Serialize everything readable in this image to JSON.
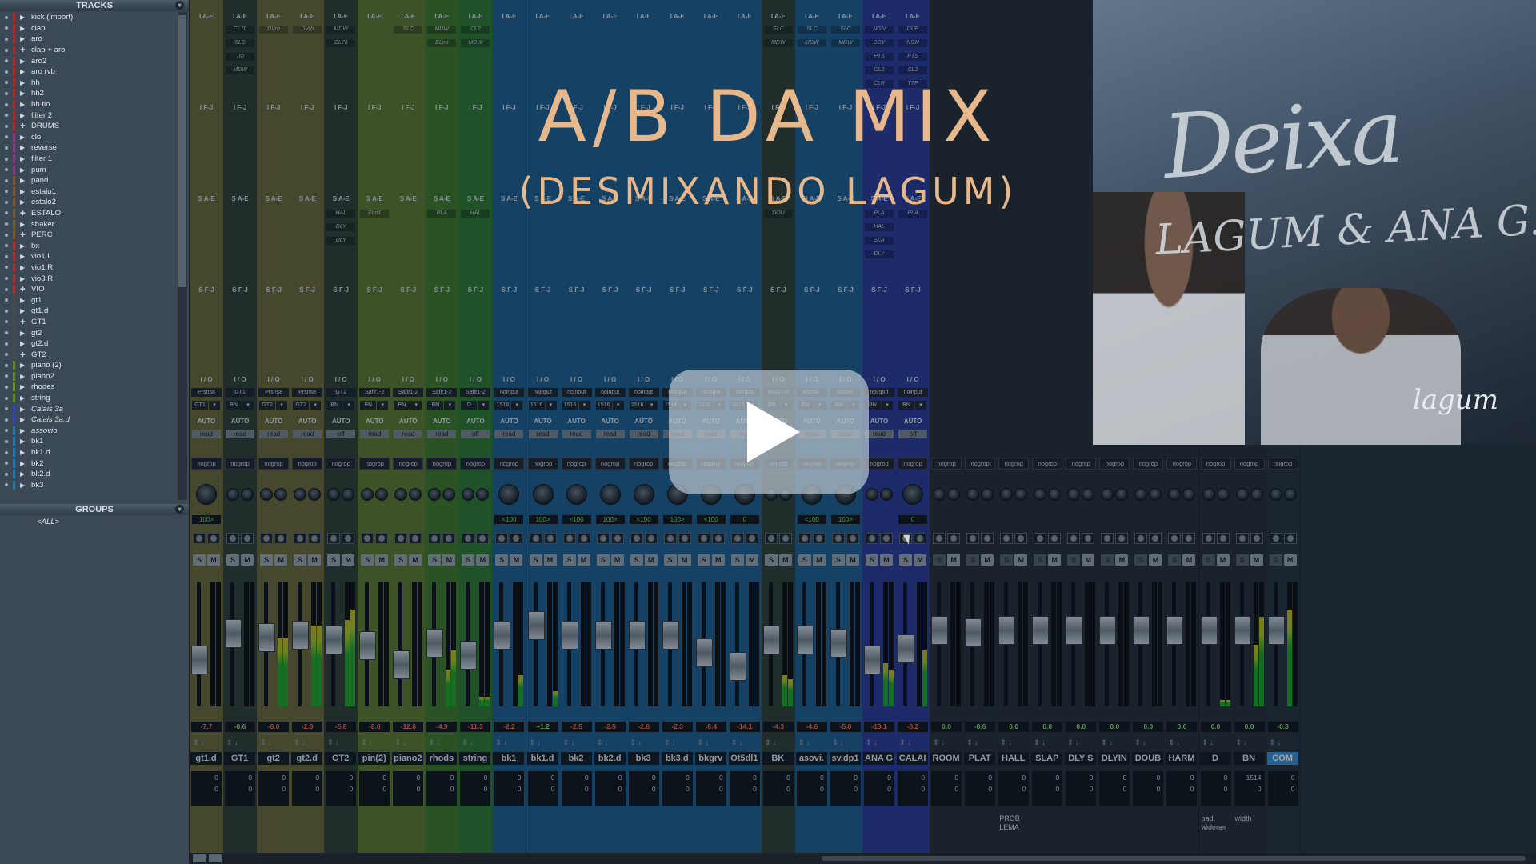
{
  "tracks_panel": {
    "header": "TRACKS",
    "tracks": [
      {
        "name": "kick (import)",
        "color": "#b02a2a",
        "arrow": "▶",
        "italic": false
      },
      {
        "name": "clap",
        "color": "#b02a2a",
        "arrow": "▶",
        "italic": false
      },
      {
        "name": "aro",
        "color": "#b02a2a",
        "arrow": "▶",
        "italic": false
      },
      {
        "name": "clap + aro",
        "color": "#b02a2a",
        "arrow": "✚",
        "italic": false
      },
      {
        "name": "aro2",
        "color": "#b02a2a",
        "arrow": "▶",
        "italic": false
      },
      {
        "name": "aro rvb",
        "color": "#b02a2a",
        "arrow": "▶",
        "italic": false
      },
      {
        "name": "hh",
        "color": "#b02a2a",
        "arrow": "▶",
        "italic": false
      },
      {
        "name": "hh2",
        "color": "#b02a2a",
        "arrow": "▶",
        "italic": false
      },
      {
        "name": "hh tio",
        "color": "#b02a2a",
        "arrow": "▶",
        "italic": false
      },
      {
        "name": "filter 2",
        "color": "#b02a2a",
        "arrow": "▶",
        "italic": false
      },
      {
        "name": "DRUMS",
        "color": "#b02a2a",
        "arrow": "✚",
        "italic": false
      },
      {
        "name": "clo",
        "color": "#8a3a8a",
        "arrow": "▶",
        "italic": false
      },
      {
        "name": "reverse",
        "color": "#8a3a8a",
        "arrow": "▶",
        "italic": false
      },
      {
        "name": "filter 1",
        "color": "#8a3a8a",
        "arrow": "▶",
        "italic": false
      },
      {
        "name": "pum",
        "color": "#8a3a8a",
        "arrow": "▶",
        "italic": false
      },
      {
        "name": "pand",
        "color": "#7a5a30",
        "arrow": "▶",
        "italic": false
      },
      {
        "name": "estalo1",
        "color": "#7a5a30",
        "arrow": "▶",
        "italic": false
      },
      {
        "name": "estalo2",
        "color": "#7a5a30",
        "arrow": "▶",
        "italic": false
      },
      {
        "name": "ESTALO",
        "color": "#7a5a30",
        "arrow": "✚",
        "italic": false
      },
      {
        "name": "shaker",
        "color": "#7a5a30",
        "arrow": "▶",
        "italic": false
      },
      {
        "name": "PERC",
        "color": "#7a5a30",
        "arrow": "✚",
        "italic": false
      },
      {
        "name": "bx",
        "color": "#b03030",
        "arrow": "▶",
        "italic": false
      },
      {
        "name": "vio1 L",
        "color": "#b03030",
        "arrow": "▶",
        "italic": false
      },
      {
        "name": "vio1 R",
        "color": "#b03030",
        "arrow": "▶",
        "italic": false
      },
      {
        "name": "vio3 R",
        "color": "#b03030",
        "arrow": "▶",
        "italic": false
      },
      {
        "name": "VIO",
        "color": "#b03030",
        "arrow": "✚",
        "italic": false
      },
      {
        "name": "gt1",
        "color": "#4a4a4a",
        "arrow": "▶",
        "italic": false
      },
      {
        "name": "gt1.d",
        "color": "#4a4a4a",
        "arrow": "▶",
        "italic": false
      },
      {
        "name": "GT1",
        "color": "#4a4a4a",
        "arrow": "✚",
        "italic": false
      },
      {
        "name": "gt2",
        "color": "#4a4a4a",
        "arrow": "▶",
        "italic": false
      },
      {
        "name": "gt2.d",
        "color": "#4a4a4a",
        "arrow": "▶",
        "italic": false
      },
      {
        "name": "GT2",
        "color": "#4a4a4a",
        "arrow": "✚",
        "italic": false
      },
      {
        "name": "piano (2)",
        "color": "#6a8a2a",
        "arrow": "▶",
        "italic": false
      },
      {
        "name": "piano2",
        "color": "#6a8a2a",
        "arrow": "▶",
        "italic": false
      },
      {
        "name": "rhodes",
        "color": "#6a8a2a",
        "arrow": "▶",
        "italic": false
      },
      {
        "name": "string",
        "color": "#6a8a2a",
        "arrow": "▶",
        "italic": false
      },
      {
        "name": "Calais 3a",
        "color": "#2a4ab0",
        "arrow": "▶",
        "italic": true
      },
      {
        "name": "Calais 3a.d",
        "color": "#2a4ab0",
        "arrow": "▶",
        "italic": true
      },
      {
        "name": "assovio",
        "color": "#2a7ab0",
        "arrow": "▶",
        "italic": true
      },
      {
        "name": "bk1",
        "color": "#2a7ab0",
        "arrow": "▶",
        "italic": false
      },
      {
        "name": "bk1.d",
        "color": "#2a7ab0",
        "arrow": "▶",
        "italic": false
      },
      {
        "name": "bk2",
        "color": "#2a7ab0",
        "arrow": "▶",
        "italic": false
      },
      {
        "name": "bk2.d",
        "color": "#2a7ab0",
        "arrow": "▶",
        "italic": false
      },
      {
        "name": "bk3",
        "color": "#2a7ab0",
        "arrow": "▶",
        "italic": false
      }
    ]
  },
  "groups_panel": {
    "header": "GROUPS",
    "groups": [
      "<ALL>"
    ]
  },
  "slot_labels": {
    "ins_ae": "I A-E",
    "ins_fj": "I F-J",
    "send_ae": "S A-E",
    "send_fj": "S F-J",
    "io": "I / O",
    "auto": "AUTO"
  },
  "strips": [
    {
      "name": "gt1.d",
      "color": "#6b6a35",
      "input": "Prsns8",
      "out": "GT1",
      "auto": "read",
      "group": "nogrop",
      "pan": "100>",
      "volume": "-7.7",
      "fader": 0.35,
      "meter_l": 0,
      "meter_r": 0,
      "delay": [
        "0",
        "0"
      ],
      "ins_ae": [],
      "send_ae": [],
      "comment": ""
    },
    {
      "name": "GT1",
      "color": "#2f3e33",
      "input": "GT1",
      "out": "BN",
      "auto": "read",
      "group": "nogrop",
      "pan": "",
      "volume": "-0.6",
      "fader": 0.62,
      "meter_l": 0,
      "meter_r": 0,
      "delay": [
        "0",
        "0"
      ],
      "ins_ae": [
        "CL76",
        "SLC",
        "Trn",
        "MDW"
      ],
      "send_ae": [],
      "comment": ""
    },
    {
      "name": "gt2",
      "color": "#6b6a35",
      "input": "Prsns8",
      "out": "GT2",
      "auto": "read",
      "group": "nogrop",
      "pan": "",
      "volume": "-6.0",
      "fader": 0.58,
      "meter_l": 0.55,
      "meter_r": 0.55,
      "delay": [
        "0",
        "0"
      ],
      "ins_ae": [
        "DVrb"
      ],
      "send_ae": [],
      "comment": ""
    },
    {
      "name": "gt2.d",
      "color": "#6b6a35",
      "input": "Prsns8",
      "out": "GT2",
      "auto": "read",
      "group": "nogrop",
      "pan": "",
      "volume": "-2.9",
      "fader": 0.6,
      "meter_l": 0.65,
      "meter_r": 0.65,
      "delay": [
        "0",
        "0"
      ],
      "ins_ae": [
        "DVrb"
      ],
      "send_ae": [],
      "comment": ""
    },
    {
      "name": "GT2",
      "color": "#2f3e33",
      "input": "GT2",
      "out": "BN",
      "auto": "off",
      "group": "nogrop",
      "pan": "",
      "volume": "-5.8",
      "fader": 0.55,
      "meter_l": 0.7,
      "meter_r": 0.78,
      "delay": [
        "0",
        "0"
      ],
      "ins_ae": [
        "MDW",
        "CL76"
      ],
      "send_ae": [
        "HAL",
        "DLY",
        "DLY"
      ],
      "comment": ""
    },
    {
      "name": "pin(2)",
      "color": "#5e7a2c",
      "input": "Safir1-2",
      "out": "BN",
      "auto": "read",
      "group": "nogrop",
      "pan": "",
      "volume": "-8.0",
      "fader": 0.5,
      "meter_l": 0,
      "meter_r": 0,
      "delay": [
        "0",
        "0"
      ],
      "ins_ae": [],
      "send_ae": [
        "Fon1"
      ],
      "comment": ""
    },
    {
      "name": "piano2",
      "color": "#5e7a2c",
      "input": "Safir1-2",
      "out": "BN",
      "auto": "read",
      "group": "nogrop",
      "pan": "",
      "volume": "-12.6",
      "fader": 0.3,
      "meter_l": 0,
      "meter_r": 0,
      "delay": [
        "0",
        "0"
      ],
      "ins_ae": [
        "SLC"
      ],
      "send_ae": [],
      "comment": ""
    },
    {
      "name": "rhods",
      "color": "#3f7a28",
      "input": "Safir1-2",
      "out": "BN",
      "auto": "read",
      "group": "nogrop",
      "pan": "",
      "volume": "-4.9",
      "fader": 0.52,
      "meter_l": 0.3,
      "meter_r": 0.45,
      "delay": [
        "0",
        "0"
      ],
      "ins_ae": [
        "MDW",
        "ELeo"
      ],
      "send_ae": [
        "PLA"
      ],
      "comment": ""
    },
    {
      "name": "string",
      "color": "#2f7a30",
      "input": "Safir1-2",
      "out": "D",
      "auto": "off",
      "group": "nogrop",
      "pan": "",
      "volume": "-11.3",
      "fader": 0.4,
      "meter_l": 0.08,
      "meter_r": 0.08,
      "delay": [
        "0",
        "0"
      ],
      "ins_ae": [
        "CL2",
        "MDW"
      ],
      "send_ae": [
        "HAL"
      ],
      "comment": ""
    },
    {
      "name": "bk1",
      "color": "#1e5f8e",
      "input": "noinput",
      "out": "1516",
      "auto": "read",
      "group": "nogrop",
      "pan": "<100",
      "volume": "-2.2",
      "fader": 0.6,
      "meter_l": 0,
      "meter_r": 0.25,
      "delay": [
        "0",
        "0"
      ],
      "ins_ae": [],
      "send_ae": [],
      "comment": ""
    },
    {
      "name": "bk1.d",
      "color": "#1e5f8e",
      "input": "noinput",
      "out": "1516",
      "auto": "read",
      "group": "nogrop",
      "pan": "100>",
      "volume": "+1.2",
      "fader": 0.7,
      "meter_l": 0,
      "meter_r": 0.12,
      "delay": [
        "0",
        "0"
      ],
      "ins_ae": [],
      "send_ae": [],
      "comment": ""
    },
    {
      "name": "bk2",
      "color": "#1e5f8e",
      "input": "noinput",
      "out": "1516",
      "auto": "read",
      "group": "nogrop",
      "pan": "<100",
      "volume": "-2.5",
      "fader": 0.6,
      "meter_l": 0,
      "meter_r": 0,
      "delay": [
        "0",
        "0"
      ],
      "ins_ae": [],
      "send_ae": [],
      "comment": ""
    },
    {
      "name": "bk2.d",
      "color": "#1e5f8e",
      "input": "noinput",
      "out": "1516",
      "auto": "read",
      "group": "nogrop",
      "pan": "100>",
      "volume": "-2.5",
      "fader": 0.6,
      "meter_l": 0,
      "meter_r": 0,
      "delay": [
        "0",
        "0"
      ],
      "ins_ae": [],
      "send_ae": [],
      "comment": ""
    },
    {
      "name": "bk3",
      "color": "#1e5f8e",
      "input": "noinput",
      "out": "1516",
      "auto": "read",
      "group": "nogrop",
      "pan": "<100",
      "volume": "-2.6",
      "fader": 0.6,
      "meter_l": 0,
      "meter_r": 0,
      "delay": [
        "0",
        "0"
      ],
      "ins_ae": [],
      "send_ae": [],
      "comment": ""
    },
    {
      "name": "bk3.d",
      "color": "#1e5f8e",
      "input": "noinput",
      "out": "1516",
      "auto": "read",
      "group": "nogrop",
      "pan": "100>",
      "volume": "-2.3",
      "fader": 0.6,
      "meter_l": 0,
      "meter_r": 0,
      "delay": [
        "0",
        "0"
      ],
      "ins_ae": [],
      "send_ae": [],
      "comment": ""
    },
    {
      "name": "bkgrv",
      "color": "#1e5f8e",
      "input": "noinput",
      "out": "1516",
      "auto": "read",
      "group": "nogrop",
      "pan": "<100",
      "volume": "-8.4",
      "fader": 0.42,
      "meter_l": 0,
      "meter_r": 0,
      "delay": [
        "0",
        "0"
      ],
      "ins_ae": [],
      "send_ae": [],
      "comment": ""
    },
    {
      "name": "Ot5dl1",
      "color": "#1e5f8e",
      "input": "noinput",
      "out": "1516",
      "auto": "read",
      "group": "nogrop",
      "pan": "0",
      "volume": "-14.1",
      "fader": 0.28,
      "meter_l": 0,
      "meter_r": 0,
      "delay": [
        "0",
        "0"
      ],
      "ins_ae": [],
      "send_ae": [],
      "comment": ""
    },
    {
      "name": "BK",
      "color": "#2f3e33",
      "input": "Bs15-16",
      "out": "BN",
      "auto": "read",
      "group": "nogrop",
      "pan": "",
      "volume": "-4.3",
      "fader": 0.55,
      "meter_l": 0.25,
      "meter_r": 0.22,
      "delay": [
        "0",
        "0"
      ],
      "ins_ae": [
        "SLC",
        "MDW"
      ],
      "send_ae": [
        "DOU"
      ],
      "comment": ""
    },
    {
      "name": "asovi.",
      "color": "#1e5f8e",
      "input": "asovio.",
      "out": "BN",
      "auto": "read",
      "group": "nogrop",
      "pan": "<100",
      "volume": "-4.6",
      "fader": 0.55,
      "meter_l": 0,
      "meter_r": 0,
      "delay": [
        "0",
        "0"
      ],
      "ins_ae": [
        "SLC",
        "MDW"
      ],
      "send_ae": [],
      "comment": ""
    },
    {
      "name": "sv.dp1",
      "color": "#1e5f8e",
      "input": "asovio.",
      "out": "BN",
      "auto": "read",
      "group": "nogrop",
      "pan": "100>",
      "volume": "-5.8",
      "fader": 0.52,
      "meter_l": 0,
      "meter_r": 0,
      "delay": [
        "0",
        "0"
      ],
      "ins_ae": [
        "SLC",
        "MDW"
      ],
      "send_ae": [],
      "comment": ""
    },
    {
      "name": "ANA G",
      "color": "#2a3a9a",
      "input": "noinput",
      "out": "BN",
      "auto": "read",
      "group": "nogrop",
      "pan": "",
      "volume": "-13.1",
      "fader": 0.35,
      "meter_l": 0.35,
      "meter_r": 0.3,
      "delay": [
        "0",
        "0"
      ],
      "ins_ae": [
        "NGN",
        "DDY",
        "PTS",
        "CL2",
        "CLR"
      ],
      "send_ae": [
        "PLA",
        "HAL",
        "SLA",
        "DLY"
      ],
      "comment": ""
    },
    {
      "name": "CALAI",
      "color": "#2a3a9a",
      "input": "noinput",
      "out": "BN",
      "auto": "off",
      "group": "nogrop",
      "pan": "0",
      "volume": "-8.2",
      "fader": 0.46,
      "meter_l": 0,
      "meter_r": 0.45,
      "delay": [
        "0",
        "0"
      ],
      "ins_ae": [
        "DUB",
        "NGN",
        "PTS",
        "CL2",
        "TTP"
      ],
      "send_ae": [
        "PLA"
      ],
      "comment": ""
    },
    {
      "name": "ROOM",
      "color": "#262e35",
      "input": "",
      "out": "",
      "auto": "",
      "group": "nogrop",
      "pan": "",
      "volume": "0.0",
      "fader": 0.65,
      "meter_l": 0,
      "meter_r": 0,
      "delay": [
        "0",
        "0"
      ],
      "ins_ae": [],
      "send_ae": [],
      "comment": ""
    },
    {
      "name": "PLAT",
      "color": "#262e35",
      "input": "",
      "out": "",
      "auto": "",
      "group": "nogrop",
      "pan": "",
      "volume": "-0.6",
      "fader": 0.63,
      "meter_l": 0,
      "meter_r": 0,
      "delay": [
        "0",
        "0"
      ],
      "ins_ae": [],
      "send_ae": [],
      "comment": ""
    },
    {
      "name": "HALL",
      "color": "#262e35",
      "input": "",
      "out": "",
      "auto": "",
      "group": "nogrop",
      "pan": "",
      "volume": "0.0",
      "fader": 0.65,
      "meter_l": 0,
      "meter_r": 0,
      "delay": [
        "0",
        "0"
      ],
      "ins_ae": [],
      "send_ae": [],
      "comment": "PROB LEMA"
    },
    {
      "name": "SLAP",
      "color": "#262e35",
      "input": "",
      "out": "",
      "auto": "",
      "group": "nogrop",
      "pan": "",
      "volume": "0.0",
      "fader": 0.65,
      "meter_l": 0,
      "meter_r": 0,
      "delay": [
        "0",
        "0"
      ],
      "ins_ae": [],
      "send_ae": [],
      "comment": ""
    },
    {
      "name": "DLY S",
      "color": "#262e35",
      "input": "",
      "out": "",
      "auto": "",
      "group": "nogrop",
      "pan": "",
      "volume": "0.0",
      "fader": 0.65,
      "meter_l": 0,
      "meter_r": 0,
      "delay": [
        "0",
        "0"
      ],
      "ins_ae": [],
      "send_ae": [],
      "comment": ""
    },
    {
      "name": "DLYIN",
      "color": "#262e35",
      "input": "",
      "out": "",
      "auto": "",
      "group": "nogrop",
      "pan": "",
      "volume": "0.0",
      "fader": 0.65,
      "meter_l": 0,
      "meter_r": 0,
      "delay": [
        "0",
        "0"
      ],
      "ins_ae": [],
      "send_ae": [],
      "comment": ""
    },
    {
      "name": "DOUB",
      "color": "#262e35",
      "input": "",
      "out": "",
      "auto": "",
      "group": "nogrop",
      "pan": "",
      "volume": "0.0",
      "fader": 0.65,
      "meter_l": 0,
      "meter_r": 0,
      "delay": [
        "0",
        "0"
      ],
      "ins_ae": [],
      "send_ae": [],
      "comment": ""
    },
    {
      "name": "HARM",
      "color": "#262e35",
      "input": "",
      "out": "",
      "auto": "",
      "group": "nogrop",
      "pan": "",
      "volume": "0.0",
      "fader": 0.65,
      "meter_l": 0,
      "meter_r": 0,
      "delay": [
        "0",
        "0"
      ],
      "ins_ae": [],
      "send_ae": [],
      "comment": ""
    },
    {
      "name": "D",
      "color": "#262e35",
      "input": "",
      "out": "",
      "auto": "",
      "group": "nogrop",
      "pan": "",
      "volume": "0.0",
      "fader": 0.65,
      "meter_l": 0.05,
      "meter_r": 0.05,
      "delay": [
        "0",
        "0"
      ],
      "ins_ae": [],
      "send_ae": [],
      "comment": "pad, widener"
    },
    {
      "name": "BN",
      "color": "#262e35",
      "input": "",
      "out": "",
      "auto": "",
      "group": "nogrop",
      "pan": "",
      "volume": "0.0",
      "fader": 0.65,
      "meter_l": 0.5,
      "meter_r": 0.72,
      "delay": [
        "1514",
        "0"
      ],
      "ins_ae": [],
      "send_ae": [],
      "comment": "width"
    },
    {
      "name": "COM",
      "color": "#26313a",
      "input": "",
      "out": "",
      "auto": "",
      "group": "nogrop",
      "pan": "",
      "volume": "-0.3",
      "fader": 0.65,
      "meter_l": 0.78,
      "meter_r": 0,
      "delay": [
        "0",
        "0"
      ],
      "ins_ae": [],
      "send_ae": [],
      "comment": ""
    }
  ],
  "video": {
    "title": "A/B DA MIX",
    "subtitle": "(DESMIXANDO LAGUM)",
    "title_color": "#e8b88d"
  },
  "album": {
    "title": "Deixa",
    "artists": "LAGUM & ANA G.",
    "logo": "lagum"
  },
  "play_icon": "play-icon"
}
